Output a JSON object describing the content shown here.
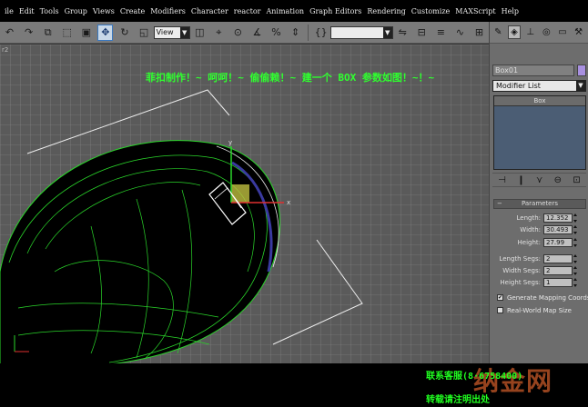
{
  "menubar": {
    "items": [
      "ile",
      "Edit",
      "Tools",
      "Group",
      "Views",
      "Create",
      "Modifiers",
      "Character",
      "reactor",
      "Animation",
      "Graph Editors",
      "Rendering",
      "Customize",
      "MAXScript",
      "Help"
    ]
  },
  "toolbar": {
    "icons": [
      "undo-icon",
      "select-object-icon",
      "select-region-icon",
      "select-move-icon",
      "select-rotate-icon",
      "select-scale-icon"
    ],
    "view_dropdown": "View",
    "named_selection_dropdown": ""
  },
  "viewport": {
    "label": "r2",
    "banner": "菲扣制作！~ 呵呵！~ 偷偷赖！~ 建一个 BOX 参数如图！~！~",
    "axis_x": "x",
    "axis_y": "y"
  },
  "command_panel": {
    "object_name": "Box01",
    "object_color": "#a890e0",
    "modifier_list": "Modifier List",
    "stack_item": "Box",
    "parameters": {
      "title": "Parameters",
      "minus": "−",
      "length_label": "Length:",
      "length_value": "12.352",
      "width_label": "Width:",
      "width_value": "30.493",
      "height_label": "Height:",
      "height_value": "27.99",
      "length_segs_label": "Length Segs:",
      "length_segs_value": "2",
      "width_segs_label": "Width Segs:",
      "width_segs_value": "2",
      "height_segs_label": "Height Segs:",
      "height_segs_value": "1",
      "gen_mapping_label": "Generate Mapping Coords.",
      "gen_mapping_checked": "✔",
      "real_world_label": "Real-World Map Size"
    }
  },
  "watermark": {
    "line1": "联系客服(8·6758400)",
    "line2": "转载请注明出处",
    "logo": "纳金网"
  },
  "colors": {
    "grid": "#7a7a7a",
    "wire": "#2ad62a",
    "banner": "#2fff2f"
  }
}
